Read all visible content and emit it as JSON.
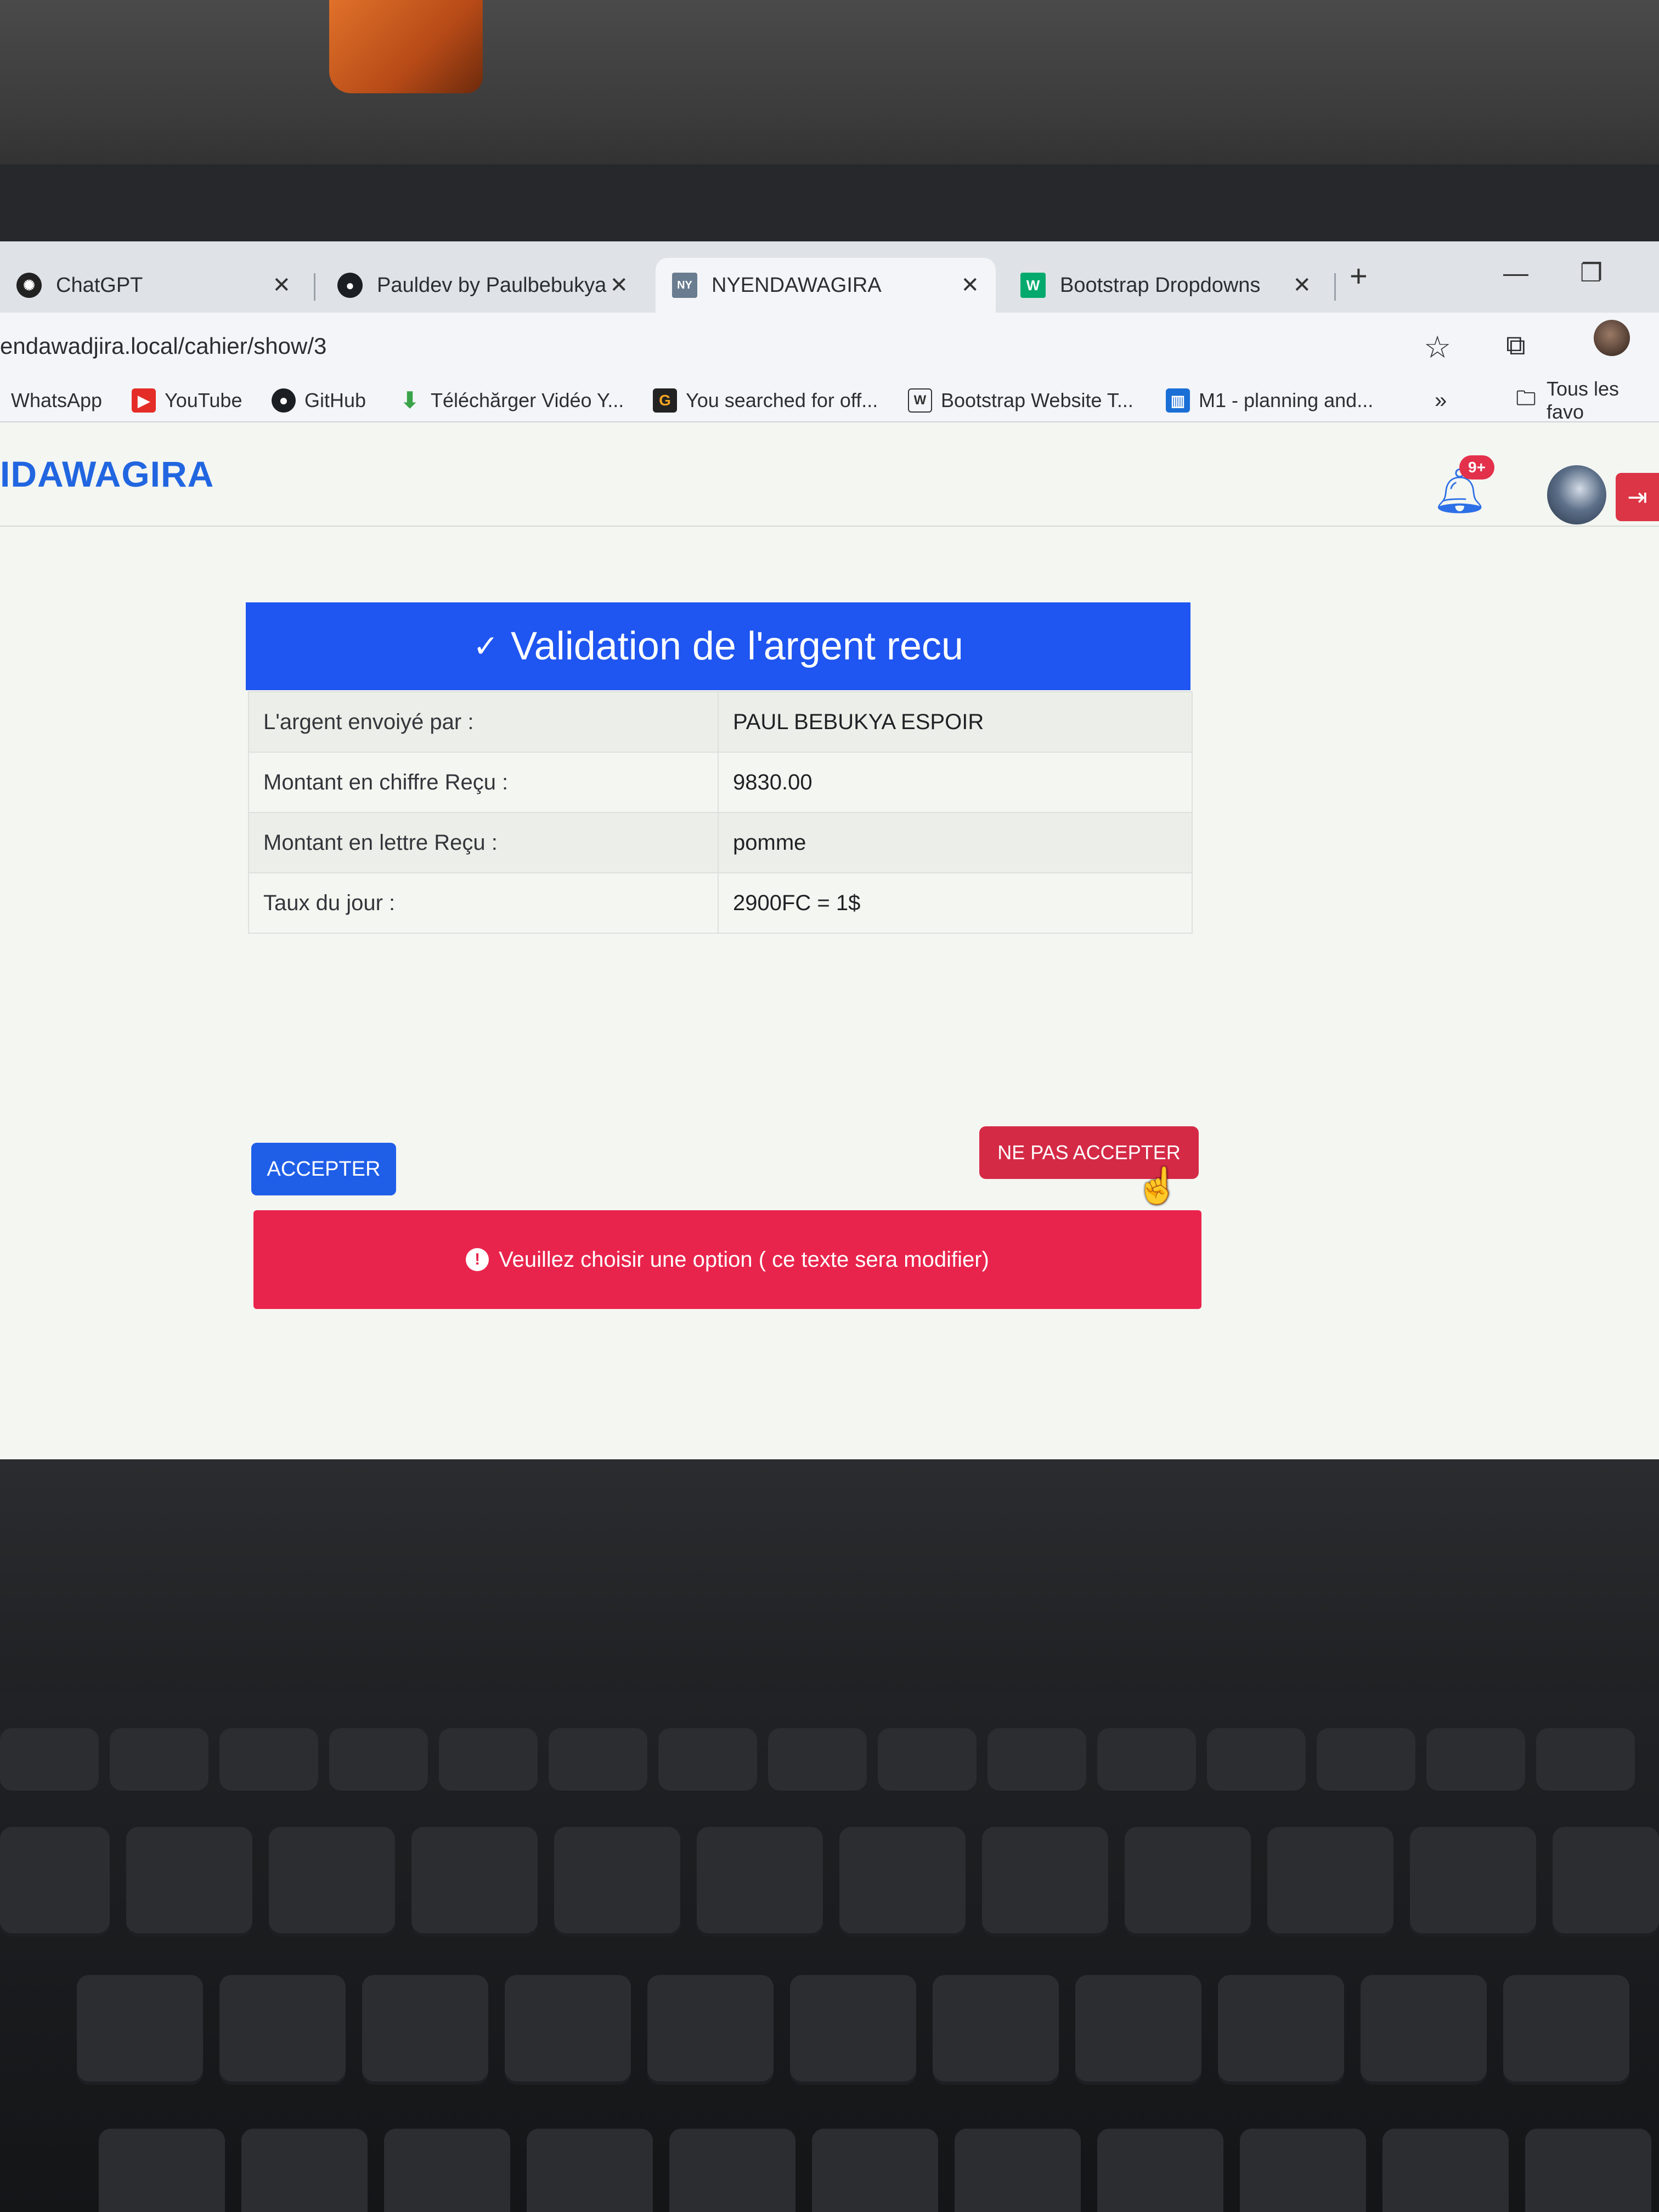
{
  "browser": {
    "tabs": [
      {
        "label": "ChatGPT",
        "icon": "chatgpt-icon",
        "active": false
      },
      {
        "label": "Pauldev by Paulbebukya",
        "icon": "github-icon",
        "active": false
      },
      {
        "label": "NYENDAWAGIRA",
        "icon": "site-favicon",
        "active": true
      },
      {
        "label": "Bootstrap Dropdowns",
        "icon": "w3-icon",
        "active": false
      }
    ],
    "close_glyph": "✕",
    "new_tab_glyph": "+",
    "url": "endawadjira.local/cahier/show/3",
    "bookmarks": [
      {
        "label": "WhatsApp"
      },
      {
        "label": "YouTube"
      },
      {
        "label": "GitHub"
      },
      {
        "label": "Téléchărger Vidéo Y..."
      },
      {
        "label": "You searched for off..."
      },
      {
        "label": "Bootstrap Website T..."
      },
      {
        "label": "M1 - planning and..."
      },
      {
        "label": "Tous les favo"
      }
    ],
    "more_bookmarks": "»"
  },
  "navbar": {
    "brand": "IDAWAGIRA",
    "notification_badge": "9+"
  },
  "card": {
    "title": "Validation de l'argent recu",
    "rows": [
      {
        "label": "L'argent envoiyé par :",
        "value": "PAUL BEBUKYA ESPOIR"
      },
      {
        "label": "Montant en chiffre Reçu :",
        "value": "9830.00"
      },
      {
        "label": "Montant en lettre Reçu :",
        "value": "pomme"
      },
      {
        "label": "Taux du jour :",
        "value": "2900FC = 1$"
      }
    ],
    "accept_label": "ACCEPTER",
    "reject_label": "NE PAS ACCEPTER",
    "alert_text": "Veuillez choisir une option ( ce texte sera modifier)"
  },
  "colors": {
    "primary": "#1f55f0",
    "danger": "#d42a46",
    "alert": "#e9244c",
    "brand": "#2166e0"
  }
}
